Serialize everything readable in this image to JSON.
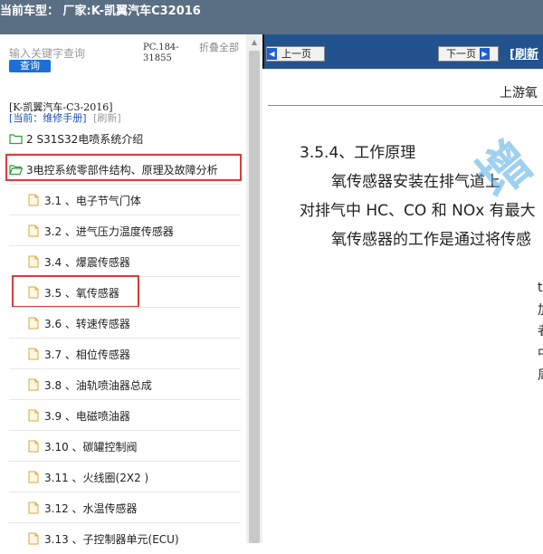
{
  "titlebar": {
    "text": "当前车型：  厂家:K-凯翼汽车C32016"
  },
  "sidebar": {
    "search_placeholder": "输入关键字查询",
    "search_button": "查询",
    "pc_code": "PC.184-31855",
    "collapse_all": "折叠全部",
    "manual_title": "[K-凯翼汽车-C3-2016]",
    "current_label": "[当前：维修手册]",
    "refresh_label": "[刷新]",
    "folders": [
      {
        "label": "2 S31S32电喷系统介绍"
      },
      {
        "label": "3电控系统零部件结构、原理及故障分析"
      }
    ],
    "items": [
      {
        "label": "3.1 、电子节气门体"
      },
      {
        "label": "3.2 、进气压力温度传感器"
      },
      {
        "label": "3.4 、爆震传感器"
      },
      {
        "label": "3.5 、氧传感器"
      },
      {
        "label": "3.6 、转速传感器"
      },
      {
        "label": "3.7 、相位传感器"
      },
      {
        "label": "3.8 、油轨喷油器总成"
      },
      {
        "label": "3.9 、电磁喷油器"
      },
      {
        "label": "3.10 、碳罐控制阀"
      },
      {
        "label": "3.11 、火线圈(2X2 )"
      },
      {
        "label": "3.12 、水温传感器"
      },
      {
        "label": "3.13 、子控制器单元(ECU)"
      }
    ]
  },
  "toolbar": {
    "prev_label": "上一页",
    "next_label": "下一页",
    "refresh_label": "[刷新"
  },
  "document": {
    "subheader": "上游氧",
    "section_heading": "3.5.4、工作原理",
    "para1": "氧传感器安装在排气道上",
    "para2": "对排气中 HC、CO 和 NOx 有最大",
    "para3": "氧传感器的工作是通过将传感",
    "watermark": "增",
    "side_fragments": [
      "t",
      "加",
      "者",
      "中",
      "周"
    ]
  },
  "colors": {
    "titlebar_bg": "#5b6f84",
    "toolbar_bg": "#22538f",
    "highlight": "#d93b3b",
    "search_button_bg": "#1c6fd6",
    "link_blue": "#1c4fb8"
  },
  "icons": {
    "open_folder": "folder-open-icon",
    "closed_folder": "folder-icon",
    "page": "page-icon",
    "prev": "arrow-left-icon",
    "next": "arrow-right-icon"
  }
}
